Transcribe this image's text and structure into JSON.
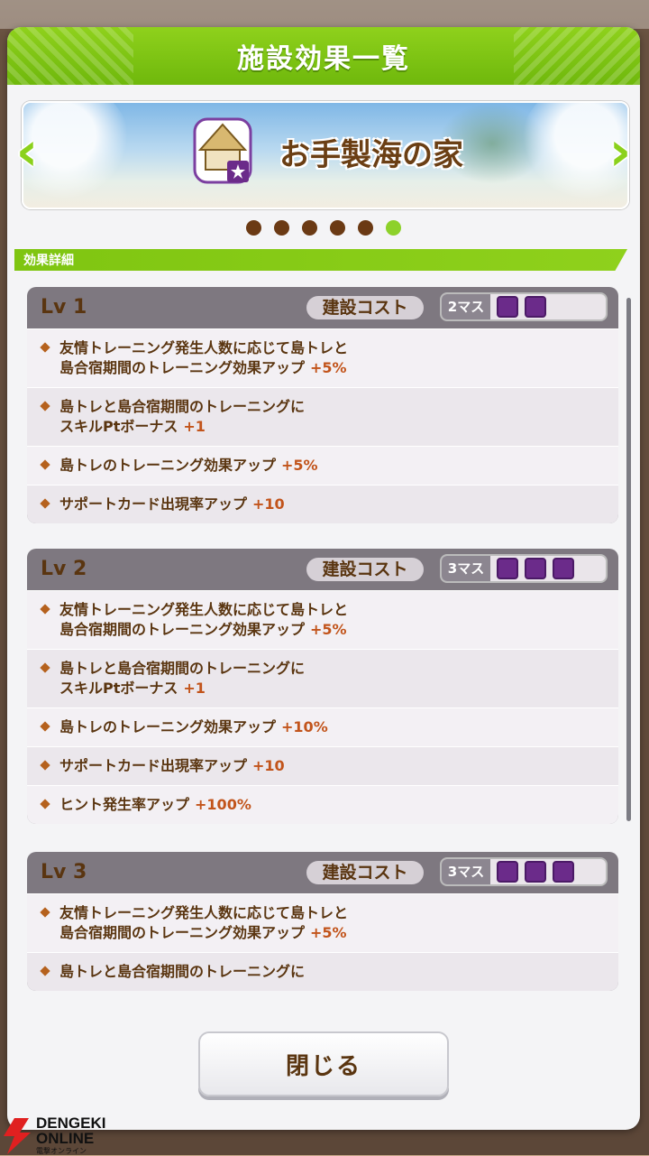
{
  "modal": {
    "title": "施設効果一覧"
  },
  "facility": {
    "name": "お手製海の家"
  },
  "pager": {
    "count": 6,
    "active_index": 5
  },
  "section": {
    "label": "効果詳細"
  },
  "cost_label": "建設コスト",
  "levels": [
    {
      "label": "Lv 1",
      "cost_text": "2マス",
      "cost_squares": 2,
      "effects": [
        {
          "text": "友情トレーニング発生人数に応じて島トレと\n島合宿期間のトレーニング効果アップ",
          "value": "+5%"
        },
        {
          "text": "島トレと島合宿期間のトレーニングに\nスキルPtボーナス",
          "value": "+1"
        },
        {
          "text": "島トレのトレーニング効果アップ",
          "value": "+5%"
        },
        {
          "text": "サポートカード出現率アップ",
          "value": "+10"
        }
      ]
    },
    {
      "label": "Lv 2",
      "cost_text": "3マス",
      "cost_squares": 3,
      "effects": [
        {
          "text": "友情トレーニング発生人数に応じて島トレと\n島合宿期間のトレーニング効果アップ",
          "value": "+5%"
        },
        {
          "text": "島トレと島合宿期間のトレーニングに\nスキルPtボーナス",
          "value": "+1"
        },
        {
          "text": "島トレのトレーニング効果アップ",
          "value": "+10%"
        },
        {
          "text": "サポートカード出現率アップ",
          "value": "+10"
        },
        {
          "text": "ヒント発生率アップ",
          "value": "+100%"
        }
      ]
    },
    {
      "label": "Lv 3",
      "cost_text": "3マス",
      "cost_squares": 3,
      "effects": [
        {
          "text": "友情トレーニング発生人数に応じて島トレと\n島合宿期間のトレーニング効果アップ",
          "value": "+5%"
        },
        {
          "text": "島トレと島合宿期間のトレーニングに",
          "value": ""
        }
      ]
    }
  ],
  "close_button": "閉じる",
  "watermark": {
    "name_top": "DENGEKI",
    "name_bottom": "ONLINE",
    "kana": "電撃オンライン"
  }
}
